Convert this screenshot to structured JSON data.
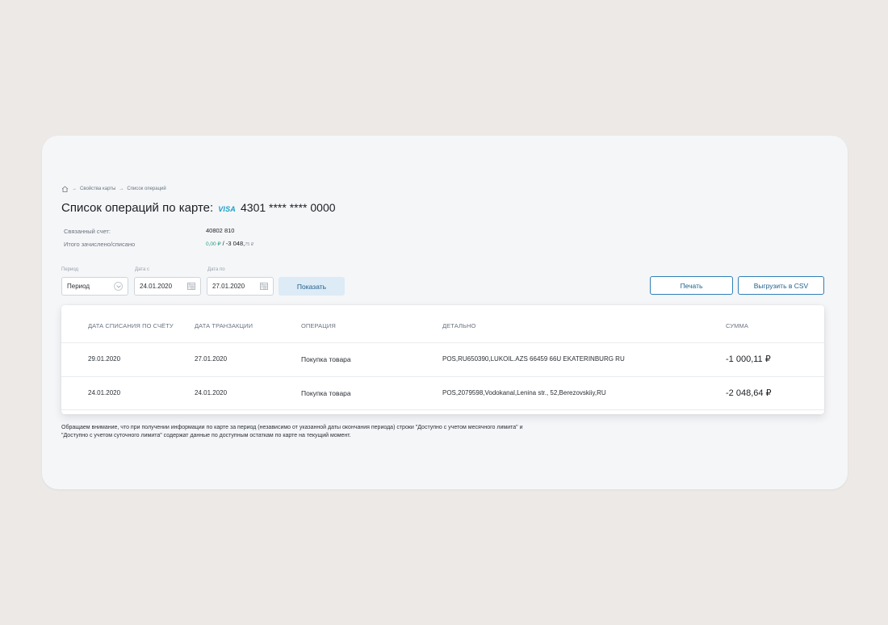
{
  "breadcrumb": {
    "items": [
      "Свойства карты",
      "Список операций"
    ]
  },
  "title": {
    "text": "Список операций по карте:",
    "brand": "VISA",
    "card_number": "4301 **** **** 0000"
  },
  "info": {
    "linked_account_label": "Связанный счет:",
    "linked_account_value": "40802 810",
    "total_label": "Итого зачислено/списано",
    "total_credit": "0,00 ₽",
    "total_separator": " / ",
    "total_debit_main": "-3 048,",
    "total_debit_cents": "75 ₽"
  },
  "filters": {
    "period_label": "Период",
    "period_value": "Период",
    "date_from_label": "Дата с",
    "date_from_value": "24.01.2020",
    "date_to_label": "Дата по",
    "date_to_value": "27.01.2020",
    "show_button": "Показать",
    "print_button": "Печать",
    "csv_button": "Выгрузить в CSV"
  },
  "table": {
    "headers": [
      "ДАТА СПИСАНИЯ ПО СЧЁТУ",
      "ДАТА ТРАНЗАКЦИИ",
      "ОПЕРАЦИЯ",
      "ДЕТАЛЬНО",
      "СУММА"
    ],
    "rows": [
      {
        "debit_date": "29.01.2020",
        "transaction_date": "27.01.2020",
        "operation": "Покупка товара",
        "details": "POS,RU650390,LUKOIL.AZS 66459 66U EKATERINBURG RU",
        "amount": "-1 000,11 ₽"
      },
      {
        "debit_date": "24.01.2020",
        "transaction_date": "24.01.2020",
        "operation": "Покупка товара",
        "details": "POS,2079598,Vodokanal,Lenina str., 52,Berezovskiiy,RU",
        "amount": "-2 048,64 ₽"
      }
    ]
  },
  "note": {
    "line1": "Обращаем внимание, что при получении информации по карте за период (независимо от указанной даты окончания периода) строки \"Доступно с учетом месячного лимита\" и",
    "line2": "\"Доступно с учетом суточного лимита\" содержат данные по доступным остаткам по карте на текущий момент."
  },
  "icons": {
    "home": "home-icon",
    "breadcrumb_arrow": "arrow-right-icon",
    "calendar": "calendar-icon",
    "dropdown": "chevron-down-icon"
  },
  "colors": {
    "accent": "#2f7fb8",
    "visa": "#1aa0c8",
    "credit_green": "#1e9b82"
  }
}
